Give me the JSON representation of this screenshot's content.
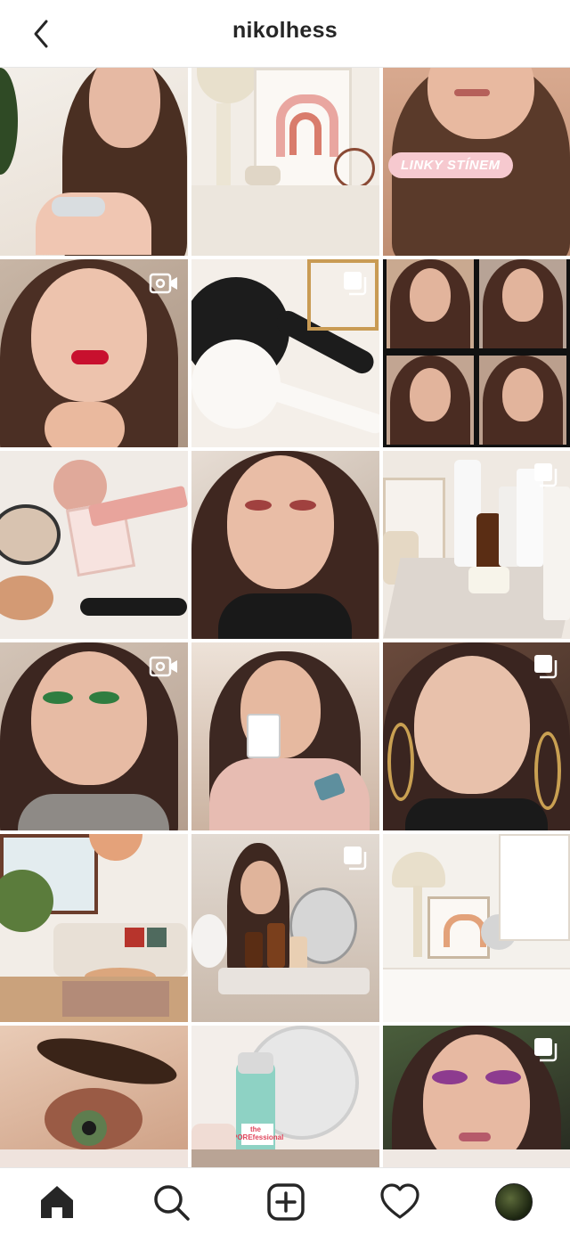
{
  "header": {
    "title": "nikolhess",
    "back_icon": "chevron-left-icon"
  },
  "grid": {
    "tiles": [
      {
        "id": "portrait-serum",
        "badge": "none"
      },
      {
        "id": "shelf-decor",
        "badge": "none"
      },
      {
        "id": "lips-closeup",
        "badge": "none",
        "label": "LINKY STÍNEM"
      },
      {
        "id": "red-lips-portrait",
        "badge": "video-icon"
      },
      {
        "id": "hair-brushes",
        "badge": "carousel-icon"
      },
      {
        "id": "collage-green-eyes",
        "badge": "none"
      },
      {
        "id": "cosmetics-flatlay",
        "badge": "none"
      },
      {
        "id": "portrait-smokey",
        "badge": "none"
      },
      {
        "id": "skincare-tray",
        "badge": "carousel-icon"
      },
      {
        "id": "green-eyeshadow",
        "badge": "video-icon"
      },
      {
        "id": "coffee-mug",
        "badge": "none"
      },
      {
        "id": "hoop-earrings",
        "badge": "carousel-icon"
      },
      {
        "id": "living-room",
        "badge": "none"
      },
      {
        "id": "vanity-mirror",
        "badge": "carousel-icon"
      },
      {
        "id": "desk-lamp",
        "badge": "none"
      },
      {
        "id": "eye-closeup",
        "badge": "none"
      },
      {
        "id": "pore-primer",
        "badge": "none",
        "label": "the POREfessional"
      },
      {
        "id": "purple-eyeshadow",
        "badge": "carousel-icon"
      }
    ]
  },
  "bottom_nav": {
    "items": [
      "home-icon",
      "search-icon",
      "new-post-icon",
      "activity-heart-icon",
      "profile-avatar"
    ]
  },
  "colors": {
    "text": "#262626",
    "pill": "#f6c9cf",
    "divider": "#e6e6e6"
  }
}
